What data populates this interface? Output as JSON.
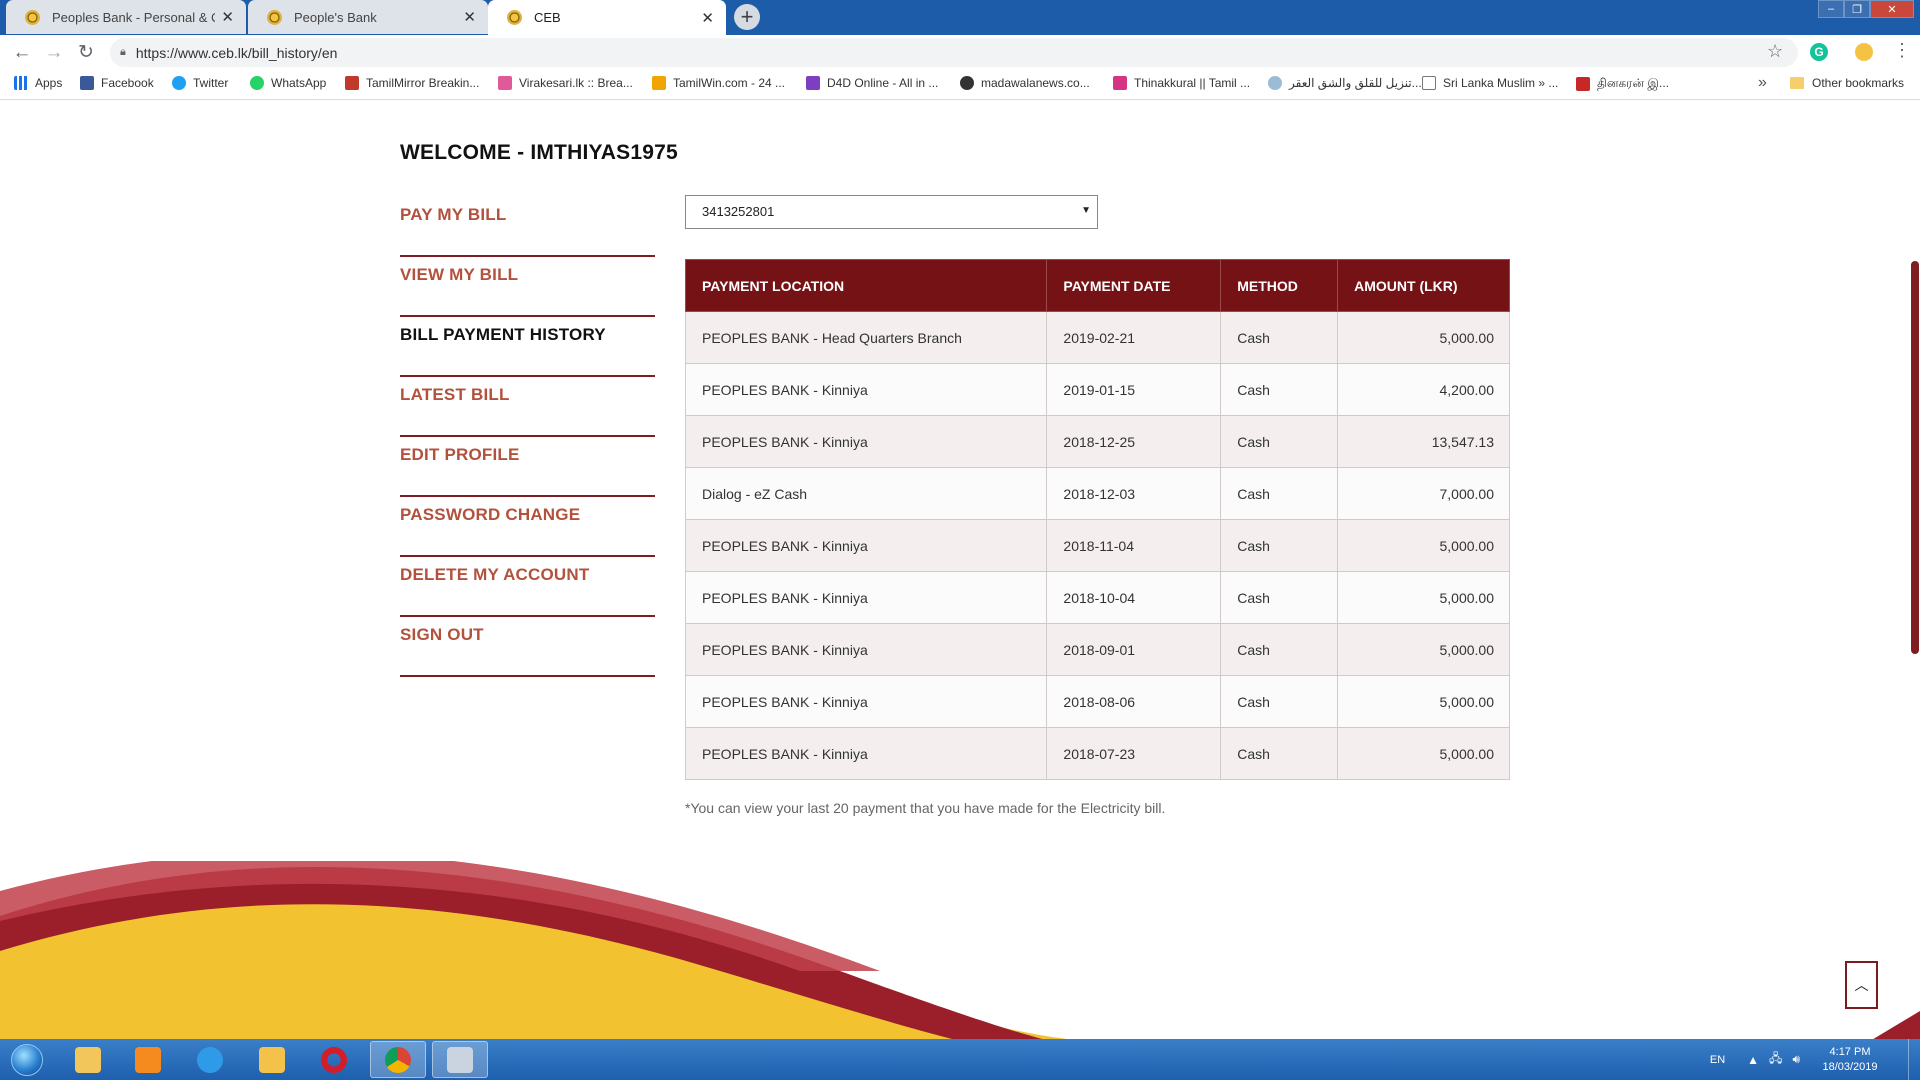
{
  "browser": {
    "tabs": [
      {
        "title": "Peoples Bank - Personal & Corpo"
      },
      {
        "title": "People's Bank"
      },
      {
        "title": "CEB"
      }
    ],
    "url": "https://www.ceb.lk/bill_history/en",
    "bookmarks": [
      {
        "label": "Apps",
        "color": "#1a73e8"
      },
      {
        "label": "Facebook",
        "color": "#3b5998"
      },
      {
        "label": "Twitter",
        "color": "#1da1f2"
      },
      {
        "label": "WhatsApp",
        "color": "#25d366"
      },
      {
        "label": "TamilMirror Breakin...",
        "color": "#c0392b"
      },
      {
        "label": "Virakesari.lk :: Brea...",
        "color": "#e05a9a"
      },
      {
        "label": "TamilWin.com - 24 ...",
        "color": "#f0a500"
      },
      {
        "label": "D4D Online - All in ...",
        "color": "#7b3fbf"
      },
      {
        "label": "madawalanews.co...",
        "color": "#333333"
      },
      {
        "label": "Thinakkural || Tamil ...",
        "color": "#d63384"
      },
      {
        "label": "تنزيل للقلق والشق العقر...",
        "color": "#9bbcd6"
      },
      {
        "label": "Sri Lanka Muslim » ...",
        "color": "#777777"
      },
      {
        "label": "தினகரன் இ...",
        "color": "#c62828"
      }
    ],
    "other_bookmarks": "Other bookmarks"
  },
  "page": {
    "welcome": "WELCOME - IMTHIYAS1975",
    "nav": [
      {
        "label": "PAY MY BILL",
        "current": false
      },
      {
        "label": "VIEW MY BILL",
        "current": false
      },
      {
        "label": "BILL PAYMENT HISTORY",
        "current": true
      },
      {
        "label": "LATEST BILL",
        "current": false
      },
      {
        "label": "EDIT PROFILE",
        "current": false
      },
      {
        "label": "PASSWORD CHANGE",
        "current": false
      },
      {
        "label": "DELETE MY ACCOUNT",
        "current": false
      },
      {
        "label": "SIGN OUT",
        "current": false
      }
    ],
    "account_select": "3413252801",
    "table": {
      "headers": [
        "PAYMENT LOCATION",
        "PAYMENT DATE",
        "METHOD",
        "AMOUNT (LKR)"
      ],
      "rows": [
        [
          "PEOPLES BANK - Head Quarters Branch",
          "2019-02-21",
          "Cash",
          "5,000.00"
        ],
        [
          "PEOPLES BANK - Kinniya",
          "2019-01-15",
          "Cash",
          "4,200.00"
        ],
        [
          "PEOPLES BANK - Kinniya",
          "2018-12-25",
          "Cash",
          "13,547.13"
        ],
        [
          "Dialog - eZ Cash",
          "2018-12-03",
          "Cash",
          "7,000.00"
        ],
        [
          "PEOPLES BANK - Kinniya",
          "2018-11-04",
          "Cash",
          "5,000.00"
        ],
        [
          "PEOPLES BANK - Kinniya",
          "2018-10-04",
          "Cash",
          "5,000.00"
        ],
        [
          "PEOPLES BANK - Kinniya",
          "2018-09-01",
          "Cash",
          "5,000.00"
        ],
        [
          "PEOPLES BANK - Kinniya",
          "2018-08-06",
          "Cash",
          "5,000.00"
        ],
        [
          "PEOPLES BANK - Kinniya",
          "2018-07-23",
          "Cash",
          "5,000.00"
        ]
      ]
    },
    "note": "*You can view your last 20 payment that you have made for the Electricity bill."
  },
  "taskbar": {
    "lang": "EN",
    "time": "4:17 PM",
    "date": "18/03/2019"
  },
  "colors": {
    "brand_maroon": "#741215",
    "nav_link": "#b3513c",
    "swoosh_yellow": "#f2c230"
  }
}
